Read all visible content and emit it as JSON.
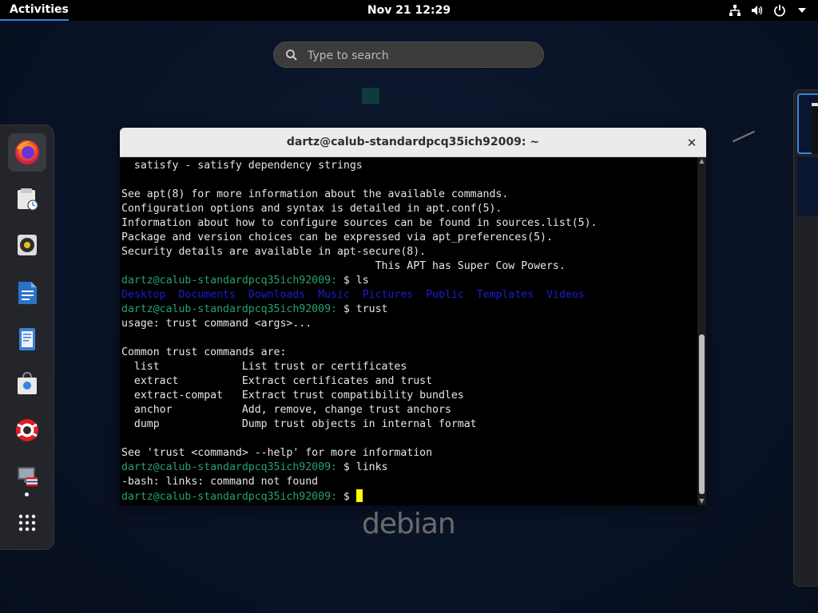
{
  "topbar": {
    "activities_label": "Activities",
    "clock": "Nov 21  12:29",
    "tray_icons": [
      "network-icon",
      "volume-icon",
      "power-icon",
      "arrow-down-icon"
    ]
  },
  "search": {
    "placeholder": "Type to search",
    "value": ""
  },
  "dash": {
    "items": [
      {
        "name": "firefox",
        "icon": "firefox-icon",
        "active": true
      },
      {
        "name": "files",
        "icon": "files-icon"
      },
      {
        "name": "rhythmbox",
        "icon": "rhythmbox-icon"
      },
      {
        "name": "writer",
        "icon": "writer-icon"
      },
      {
        "name": "text-editor",
        "icon": "text-editor-icon"
      },
      {
        "name": "software",
        "icon": "software-icon"
      },
      {
        "name": "help",
        "icon": "help-icon"
      },
      {
        "name": "settings",
        "icon": "settings-icon",
        "running": true
      },
      {
        "name": "show-apps",
        "icon": "grid-icon"
      }
    ]
  },
  "terminal": {
    "title": "dartz@calub-standardpcq35ich92009: ~",
    "lines": [
      {
        "type": "text",
        "text": "  satisfy - satisfy dependency strings"
      },
      {
        "type": "text",
        "text": ""
      },
      {
        "type": "text",
        "text": "See apt(8) for more information about the available commands."
      },
      {
        "type": "text",
        "text": "Configuration options and syntax is detailed in apt.conf(5)."
      },
      {
        "type": "text",
        "text": "Information about how to configure sources can be found in sources.list(5)."
      },
      {
        "type": "text",
        "text": "Package and version choices can be expressed via apt_preferences(5)."
      },
      {
        "type": "text",
        "text": "Security details are available in apt-secure(8)."
      },
      {
        "type": "text",
        "text": "                                        This APT has Super Cow Powers."
      },
      {
        "type": "prompt",
        "prompt": "dartz@calub-standardpcq35ich92009:",
        "cmd": " $ ls"
      },
      {
        "type": "dirs",
        "dirs": [
          "Desktop",
          "Documents",
          "Downloads",
          "Music",
          "Pictures",
          "Public",
          "Templates",
          "Videos"
        ]
      },
      {
        "type": "prompt",
        "prompt": "dartz@calub-standardpcq35ich92009:",
        "cmd": " $ trust"
      },
      {
        "type": "text",
        "text": "usage: trust command <args>..."
      },
      {
        "type": "text",
        "text": ""
      },
      {
        "type": "text",
        "text": "Common trust commands are:"
      },
      {
        "type": "text",
        "text": "  list             List trust or certificates"
      },
      {
        "type": "text",
        "text": "  extract          Extract certificates and trust"
      },
      {
        "type": "text",
        "text": "  extract-compat   Extract trust compatibility bundles"
      },
      {
        "type": "text",
        "text": "  anchor           Add, remove, change trust anchors"
      },
      {
        "type": "text",
        "text": "  dump             Dump trust objects in internal format"
      },
      {
        "type": "text",
        "text": ""
      },
      {
        "type": "text",
        "text": "See 'trust <command> --help' for more information"
      },
      {
        "type": "prompt",
        "prompt": "dartz@calub-standardpcq35ich92009:",
        "cmd": " $ links"
      },
      {
        "type": "text",
        "text": "-bash: links: command not found"
      },
      {
        "type": "prompt",
        "prompt": "dartz@calub-standardpcq35ich92009:",
        "cmd": " $ ",
        "cursor": true
      }
    ]
  },
  "watermark": "debian",
  "colors": {
    "prompt": "#26a269",
    "dirs": "#1c1cd0",
    "cursor": "#ffff00",
    "accent": "#3584e4"
  }
}
